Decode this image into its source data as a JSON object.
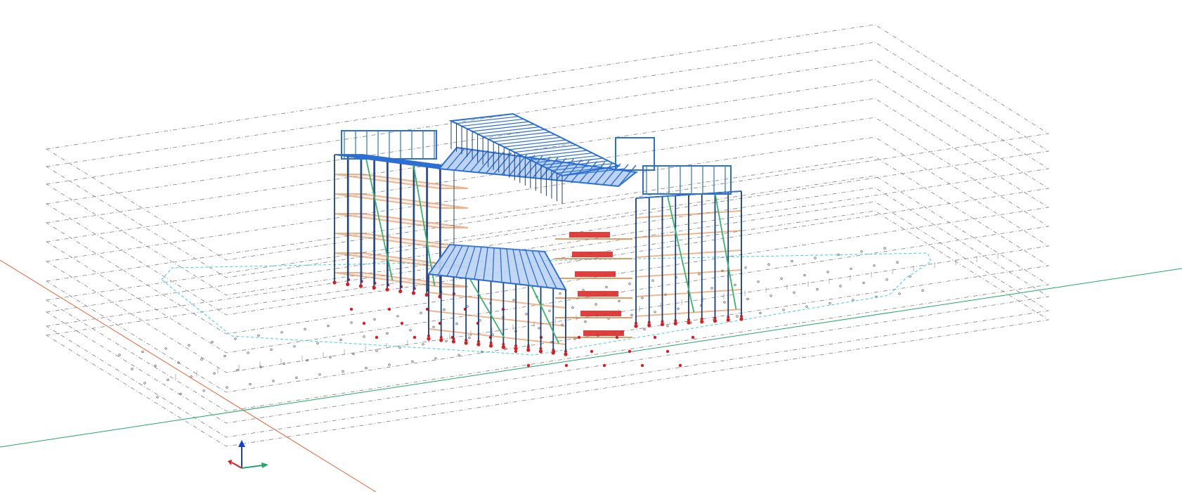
{
  "viewport": {
    "background": "#ffffff"
  },
  "colors": {
    "grid_line": "#555555",
    "axis_x": "#e8623a",
    "axis_y": "#23a66b",
    "axis_z": "#1a3fd1",
    "beam_blue": "#2a6fd6",
    "column_navy": "#1c3f7a",
    "floor_beam_orange": "#e07a2f",
    "slab_fill": "#f7e1d8",
    "bracing_green": "#34b66b",
    "support_red": "#d81e1e",
    "outline_cyan": "#3fd0d8"
  },
  "axis_triad": {
    "x_label_icon": "triad-x-arrow",
    "y_label_icon": "triad-y-arrow",
    "z_label_icon": "triad-z-arrow"
  }
}
